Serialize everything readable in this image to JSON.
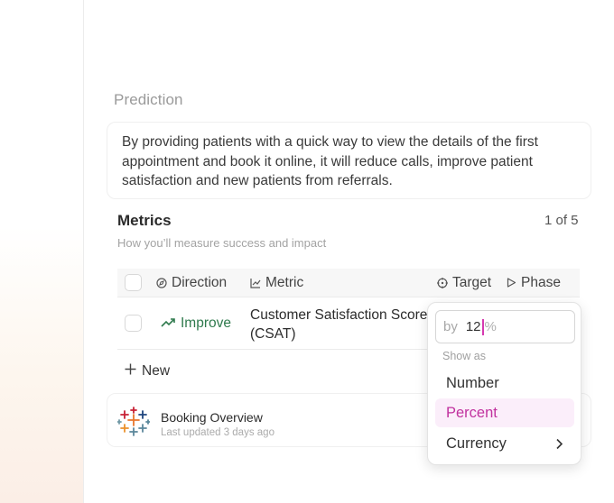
{
  "prediction": {
    "label": "Prediction",
    "text": "By providing patients with a quick way to view the details of the first appointment and book it online, it will reduce calls, improve patient satisfaction and new patients from referrals."
  },
  "metrics": {
    "title": "Metrics",
    "subtitle": "How you’ll measure success and impact",
    "count": "1 of 5",
    "columns": {
      "direction": "Direction",
      "metric": "Metric",
      "target": "Target",
      "phase": "Phase"
    },
    "rows": [
      {
        "direction": "Improve",
        "metric": "Customer Satisfaction Score (CSAT)"
      }
    ],
    "new_label": "New"
  },
  "booking": {
    "title": "Booking Overview",
    "subtitle": "Last updated 3 days ago"
  },
  "target_dropdown": {
    "prefix": "by",
    "value": "12",
    "suffix": "%",
    "show_as_label": "Show as",
    "options": [
      "Number",
      "Percent",
      "Currency"
    ],
    "selected": "Percent"
  },
  "colors": {
    "improve_green": "#2f7a4d",
    "selected_pink": "#c1329f",
    "selected_bg": "#fbeefa"
  },
  "icons": {
    "direction": "compass-icon",
    "metric": "chart-line-icon",
    "target": "target-icon",
    "phase": "flag-icon",
    "improve": "trend-up-icon",
    "new": "plus-icon",
    "currency_more": "chevron-right-icon",
    "booking": "tableau-logo-icon"
  }
}
